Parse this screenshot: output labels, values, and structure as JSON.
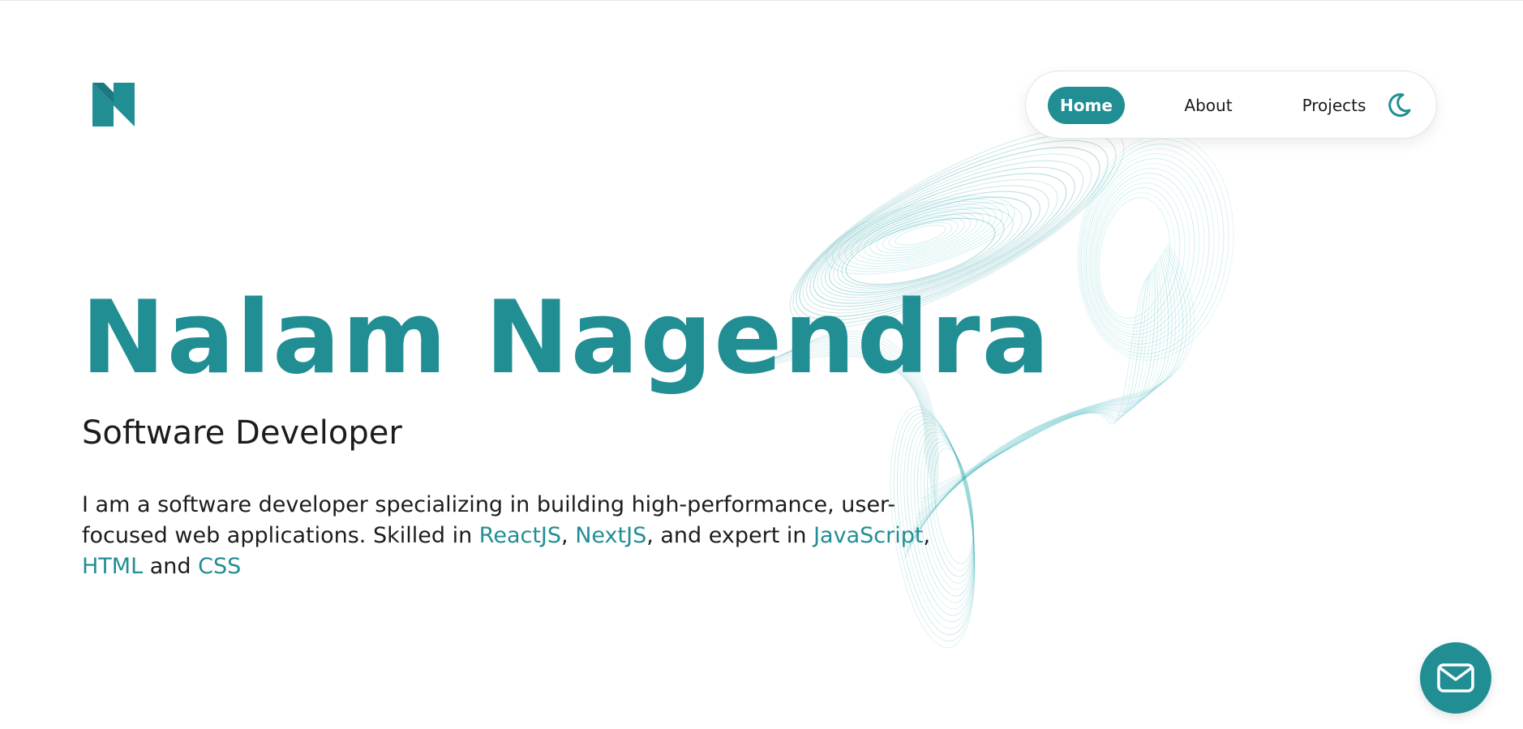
{
  "brand": {
    "logo_icon": "n-monogram-logo",
    "accent_color": "#218e94"
  },
  "nav": {
    "items": [
      {
        "label": "Home",
        "active": true
      },
      {
        "label": "About",
        "active": false
      },
      {
        "label": "Projects",
        "active": false
      }
    ],
    "theme_toggle_icon": "moon-icon"
  },
  "hero": {
    "name": "Nalam Nagendra",
    "role": "Software Developer",
    "bio": {
      "part1": "I am a software developer specializing in building high-performance, user-focused web applications. Skilled in ",
      "skill1": "ReactJS",
      "sep1": ", ",
      "skill2": "NextJS",
      "part2": ", and expert in ",
      "skill3": "JavaScript",
      "sep2": ", ",
      "skill4": "HTML",
      "sep3": " and ",
      "skill5": "CSS"
    }
  },
  "contact": {
    "fab_icon": "mail-icon"
  }
}
